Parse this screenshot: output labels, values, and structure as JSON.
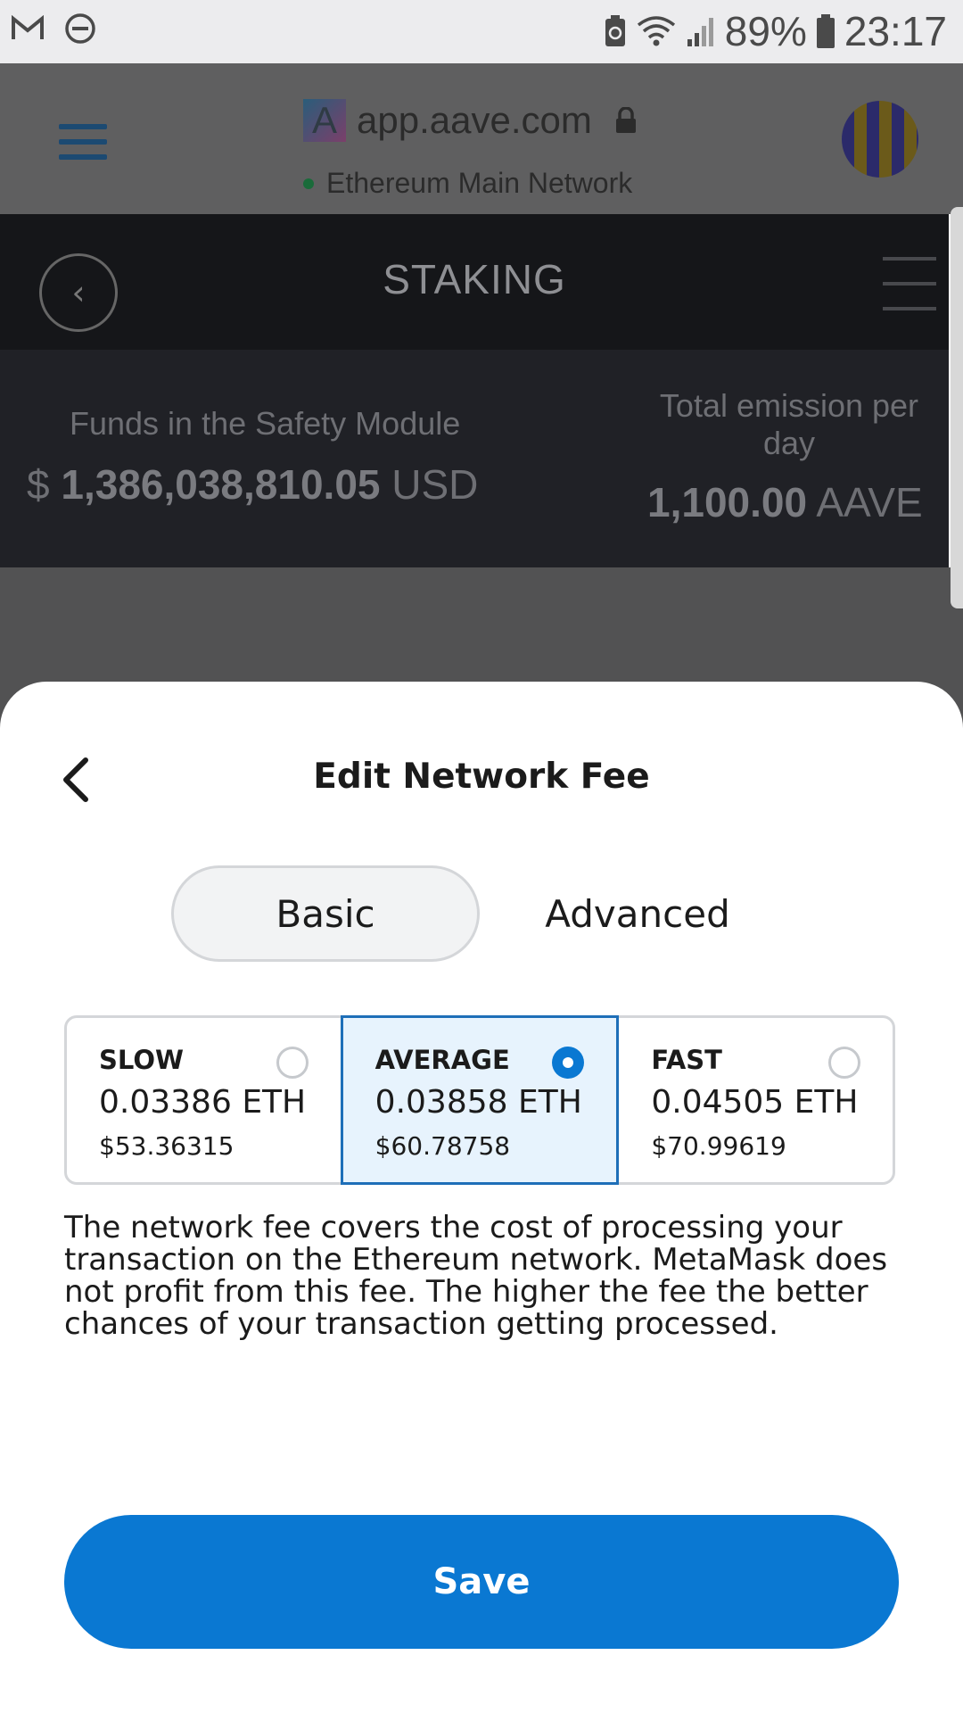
{
  "status_bar": {
    "battery_percent": "89%",
    "time": "23:17",
    "left_icons": [
      "gmail-icon",
      "do-not-disturb-icon"
    ],
    "right_icons": [
      "battery-saver-icon",
      "wifi-icon",
      "signal-icon",
      "battery-icon"
    ]
  },
  "browser": {
    "url": "app.aave.com",
    "network": "Ethereum Main Network",
    "network_dot_color": "#1a6b3a"
  },
  "staking": {
    "title": "STAKING",
    "funds_label": "Funds in the Safety Module",
    "funds_currency_symbol": "$",
    "funds_value": "1,386,038,810.05",
    "funds_unit": "USD",
    "emission_label": "Total emission per day",
    "emission_value": "1,100.00",
    "emission_unit": "AAVE"
  },
  "sheet": {
    "title": "Edit Network Fee",
    "tabs": [
      {
        "label": "Basic",
        "active": true
      },
      {
        "label": "Advanced",
        "active": false
      }
    ],
    "fee_options": [
      {
        "name": "SLOW",
        "eth": "0.03386 ETH",
        "usd": "$53.36315",
        "selected": false
      },
      {
        "name": "AVERAGE",
        "eth": "0.03858 ETH",
        "usd": "$60.78758",
        "selected": true
      },
      {
        "name": "FAST",
        "eth": "0.04505 ETH",
        "usd": "$70.99619",
        "selected": false
      }
    ],
    "note": "The network fee covers the cost of processing your transaction on the Ethereum network. MetaMask does not profit from this fee. The higher the fee the better chances of your transaction getting processed.",
    "save_label": "Save"
  },
  "colors": {
    "accent": "#0a78d2",
    "selected_bg": "#e7f3fd",
    "selected_border": "#1e6fb8"
  }
}
